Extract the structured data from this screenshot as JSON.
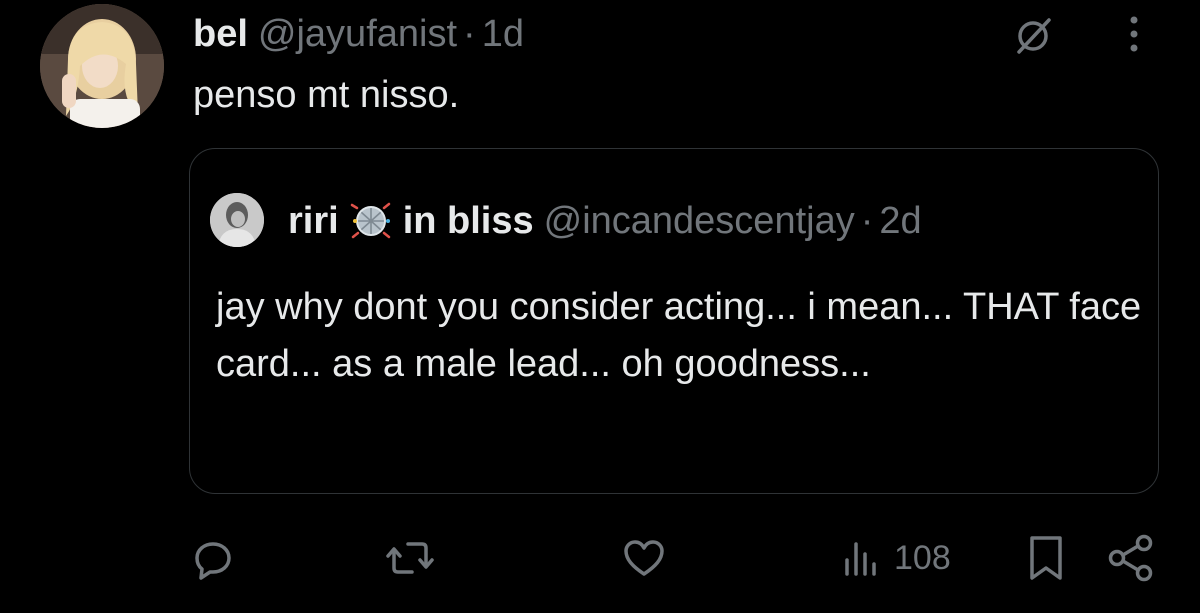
{
  "tweet": {
    "display_name": "bel",
    "handle": "@jayufanist",
    "separator": "·",
    "time": "1d",
    "text": "penso mt nisso."
  },
  "quoted_tweet": {
    "display_name_before": "riri",
    "display_name_after": "in bliss",
    "emoji_icon": "disco-ball-emoji-icon",
    "handle": "@incandescentjay",
    "separator": "·",
    "time": "2d",
    "text": "jay why dont you consider acting... i mean... THAT face card... as a male lead... oh goodness..."
  },
  "actions": {
    "views": "108"
  },
  "colors": {
    "background": "#000000",
    "text": "#e7e9ea",
    "secondary": "#71767b",
    "border": "#2f3336"
  }
}
